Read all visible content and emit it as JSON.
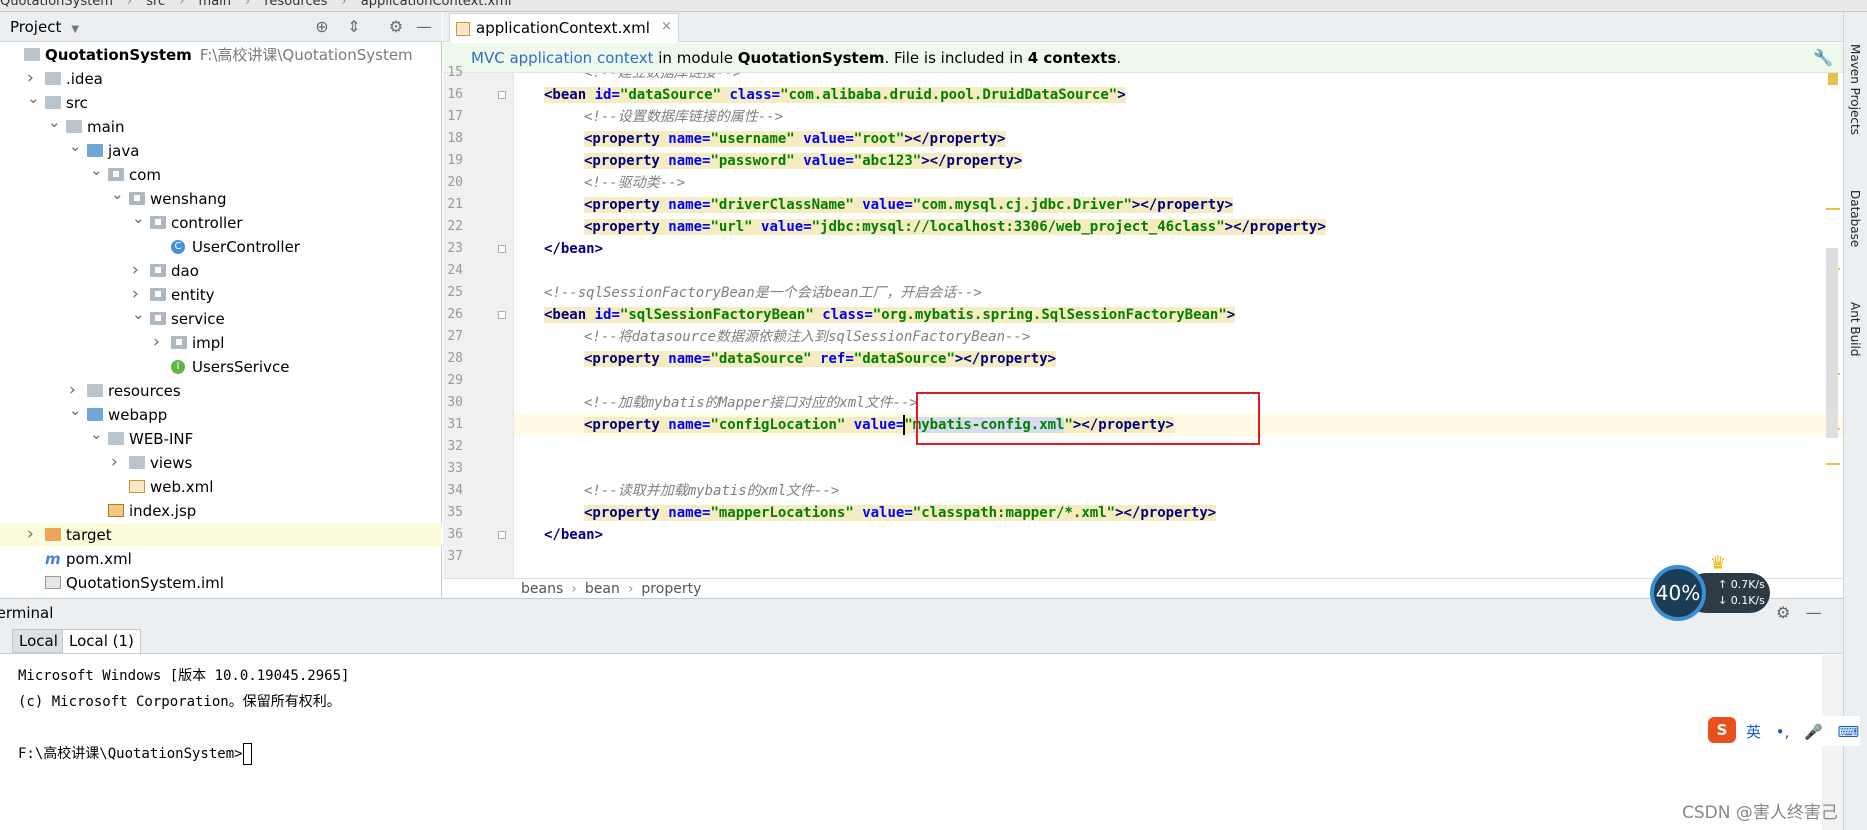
{
  "breadcrumb": [
    "QuotationSystem",
    "src",
    "main",
    "resources",
    "applicationContext.xml"
  ],
  "project_panel": {
    "title": "Project",
    "tree": [
      {
        "label": "QuotationSystem",
        "path": "F:\\高校讲课\\QuotationSystem",
        "depth": 0,
        "icon": "project-folder-icon",
        "arrow": ""
      },
      {
        "label": ".idea",
        "depth": 1,
        "icon": "folder-icon",
        "arrow": "›"
      },
      {
        "label": "src",
        "depth": 1,
        "icon": "folder-icon",
        "arrow": "⌄"
      },
      {
        "label": "main",
        "depth": 2,
        "icon": "folder-icon",
        "arrow": "⌄"
      },
      {
        "label": "java",
        "depth": 3,
        "icon": "source-folder-icon",
        "arrow": "⌄"
      },
      {
        "label": "com",
        "depth": 4,
        "icon": "package-icon",
        "arrow": "⌄"
      },
      {
        "label": "wenshang",
        "depth": 5,
        "icon": "package-icon",
        "arrow": "⌄"
      },
      {
        "label": "controller",
        "depth": 6,
        "icon": "package-icon",
        "arrow": "⌄"
      },
      {
        "label": "UserController",
        "depth": 7,
        "icon": "class-icon",
        "arrow": ""
      },
      {
        "label": "dao",
        "depth": 6,
        "icon": "package-icon",
        "arrow": "›"
      },
      {
        "label": "entity",
        "depth": 6,
        "icon": "package-icon",
        "arrow": "›"
      },
      {
        "label": "service",
        "depth": 6,
        "icon": "package-icon",
        "arrow": "⌄"
      },
      {
        "label": "impl",
        "depth": 7,
        "icon": "package-icon",
        "arrow": "›"
      },
      {
        "label": "UsersSerivce",
        "depth": 7,
        "icon": "interface-icon",
        "arrow": ""
      },
      {
        "label": "resources",
        "depth": 3,
        "icon": "resources-folder-icon",
        "arrow": "›"
      },
      {
        "label": "webapp",
        "depth": 3,
        "icon": "web-folder-icon",
        "arrow": "⌄"
      },
      {
        "label": "WEB-INF",
        "depth": 4,
        "icon": "folder-icon",
        "arrow": "⌄"
      },
      {
        "label": "views",
        "depth": 5,
        "icon": "folder-icon",
        "arrow": "›"
      },
      {
        "label": "web.xml",
        "depth": 5,
        "icon": "xml-file-icon",
        "arrow": ""
      },
      {
        "label": "index.jsp",
        "depth": 4,
        "icon": "jsp-file-icon",
        "arrow": ""
      },
      {
        "label": "target",
        "depth": 1,
        "icon": "excluded-folder-icon",
        "arrow": "›"
      },
      {
        "label": "pom.xml",
        "depth": 1,
        "icon": "maven-icon",
        "arrow": ""
      },
      {
        "label": "QuotationSystem.iml",
        "depth": 1,
        "icon": "iml-file-icon",
        "arrow": ""
      }
    ]
  },
  "editor": {
    "tab_label": "applicationContext.xml",
    "tab_close": "×",
    "notification": {
      "link": "MVC application context",
      "text1": " in module ",
      "module": "QuotationSystem",
      "text2": ". File is included in ",
      "count": "4 contexts",
      "text3": "."
    },
    "first_line_partial": "<!--建立数据库链接-->",
    "lines": [
      {
        "n": "15"
      },
      {
        "n": "16"
      },
      {
        "n": "17"
      },
      {
        "n": "18"
      },
      {
        "n": "19"
      },
      {
        "n": "20"
      },
      {
        "n": "21"
      },
      {
        "n": "22"
      },
      {
        "n": "23"
      },
      {
        "n": "24"
      },
      {
        "n": "25"
      },
      {
        "n": "26"
      },
      {
        "n": "27"
      },
      {
        "n": "28"
      },
      {
        "n": "29"
      },
      {
        "n": "30"
      },
      {
        "n": "31"
      },
      {
        "n": "32"
      },
      {
        "n": "33"
      },
      {
        "n": "34"
      },
      {
        "n": "35"
      },
      {
        "n": "36"
      },
      {
        "n": "37"
      }
    ],
    "code": {
      "l16": {
        "bean": "bean",
        "id": "dataSource",
        "class": "com.alibaba.druid.pool.DruidDataSource"
      },
      "l17": "<!--设置数据库链接的属性-->",
      "l18": {
        "name": "username",
        "value": "root"
      },
      "l19": {
        "name": "password",
        "value": "abc123"
      },
      "l20": "<!--驱动类-->",
      "l21": {
        "name": "driverClassName",
        "value": "com.mysql.cj.jdbc.Driver"
      },
      "l22": {
        "name": "url",
        "value": "jdbc:mysql://localhost:3306/web_project_46class"
      },
      "l23": "</bean>",
      "l25": "<!--sqlSessionFactoryBean是一个会话bean工厂，开启会话-->",
      "l26": {
        "id": "sqlSessionFactoryBean",
        "class": "org.mybatis.spring.SqlSessionFactoryBean"
      },
      "l27": "<!--将datasource数据源依赖注入到sqlSessionFactoryBean-->",
      "l28": {
        "name": "dataSource",
        "ref": "dataSource"
      },
      "l30": "<!--加载mybatis的Mapper接口对应的xml文件-->",
      "l31": {
        "name": "configLocation",
        "value": "mybatis-config.xml"
      },
      "l34": "<!--读取并加载mybatis的xml文件-->",
      "l35": {
        "name": "mapperLocations",
        "value": "classpath:mapper/*.xml"
      },
      "l36": "</bean>"
    },
    "status_breadcrumb": [
      "beans",
      "bean",
      "property"
    ]
  },
  "right_sidebar": [
    "Maven Projects",
    "Database",
    "Ant Build"
  ],
  "terminal": {
    "title": "Terminal",
    "tabs": [
      "Local",
      "Local (1)"
    ],
    "output": [
      "Microsoft Windows [版本 10.0.19045.2965]",
      "(c) Microsoft Corporation。保留所有权利。",
      "",
      "F:\\高校讲课\\QuotationSystem>"
    ]
  },
  "perf_widget": {
    "percent": "40%",
    "up": "0.7K/s",
    "down": "0.1K/s"
  },
  "ime_toolbar": {
    "logo": "S",
    "items": [
      "英",
      "•,",
      "🎤",
      "⌨",
      "▦"
    ]
  },
  "watermark": "CSDN @害人终害己",
  "colors": {
    "highlight_box": "#e01e1e",
    "tag_bg": "#f6ecc2",
    "notify_bg": "#eef9ec"
  }
}
